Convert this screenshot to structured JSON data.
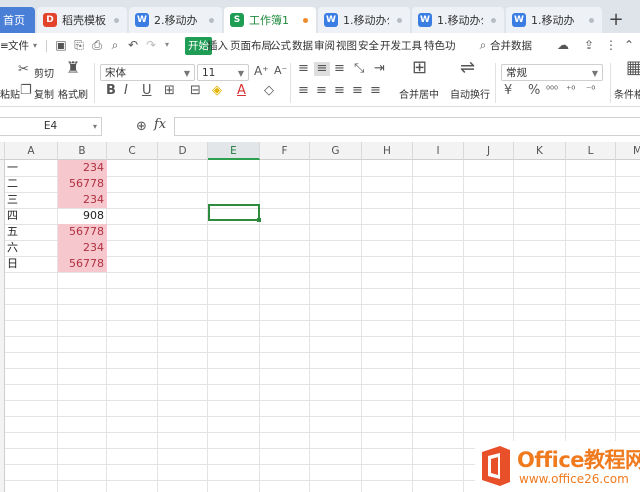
{
  "tabs": {
    "home": "首页",
    "items": [
      {
        "label": "稻壳模板",
        "icon": "D",
        "color": "#e2432a"
      },
      {
        "label": "2.移动办",
        "icon": "W",
        "color": "#3b7ee3"
      },
      {
        "label": "工作簿1",
        "icon": "S",
        "color": "#1f9d55"
      },
      {
        "label": "1.移动办公",
        "icon": "W",
        "color": "#3b7ee3"
      },
      {
        "label": "1.移动办公",
        "icon": "W",
        "color": "#3b7ee3"
      },
      {
        "label": "1.移动办",
        "icon": "W",
        "color": "#3b7ee3"
      }
    ],
    "new_tab": "+"
  },
  "menu": {
    "file": "文件",
    "items": [
      "开始",
      "插入",
      "页面布局",
      "公式",
      "数据",
      "审阅",
      "视图",
      "安全",
      "开发工具",
      "特色功"
    ],
    "search": "合并数据"
  },
  "ribbon": {
    "cut": "剪切",
    "paste": "粘贴",
    "copy": "复制",
    "format_painter": "格式刷",
    "font_name": "宋体",
    "font_size": "11",
    "merge_center": "合并居中",
    "wrap_text": "自动换行",
    "number_format": "常规",
    "conditional_format": "条件格"
  },
  "formula_bar": {
    "name_box": "E4",
    "fx": "fx",
    "formula": ""
  },
  "grid": {
    "columns": [
      "A",
      "B",
      "C",
      "D",
      "E",
      "F",
      "G",
      "H",
      "I",
      "J",
      "K",
      "L",
      "M"
    ],
    "selected_column": "E",
    "rows": [
      {
        "a": "一",
        "b": "234",
        "highlight": true
      },
      {
        "a": "二",
        "b": "56778",
        "highlight": true
      },
      {
        "a": "三",
        "b": "234",
        "highlight": true
      },
      {
        "a": "四",
        "b": "908",
        "highlight": false
      },
      {
        "a": "五",
        "b": "56778",
        "highlight": true
      },
      {
        "a": "六",
        "b": "234",
        "highlight": true
      },
      {
        "a": "日",
        "b": "56778",
        "highlight": true
      }
    ]
  },
  "watermark": {
    "brand": "Office教程网",
    "url": "www.office26.com"
  }
}
